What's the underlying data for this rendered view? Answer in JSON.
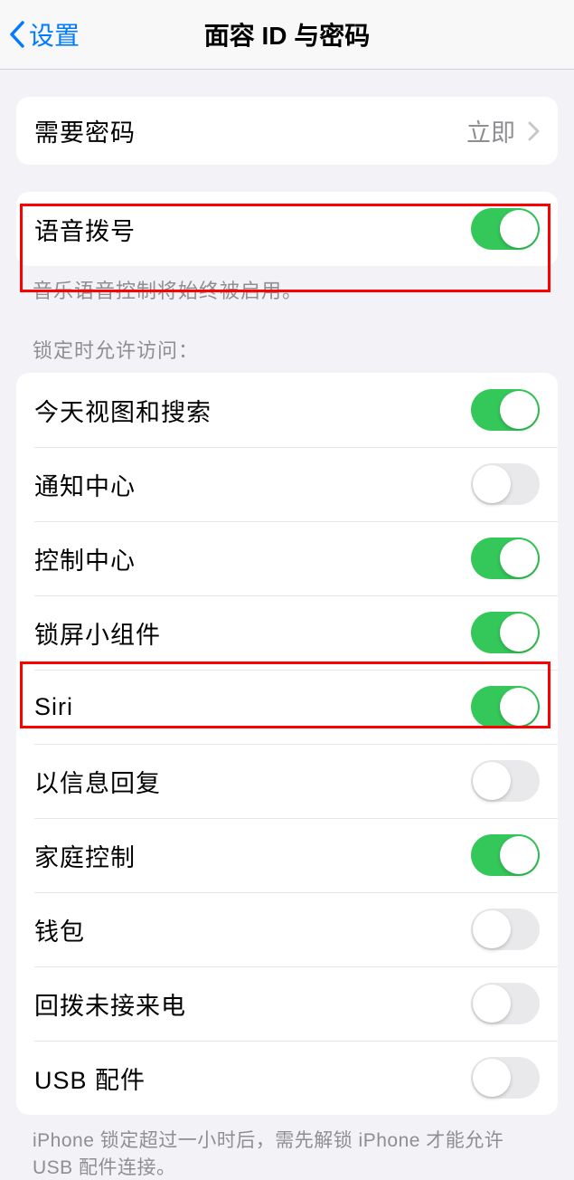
{
  "nav": {
    "back_label": "设置",
    "title": "面容 ID 与密码"
  },
  "passcode_group": {
    "require_passcode_label": "需要密码",
    "require_passcode_value": "立即"
  },
  "voice_dial": {
    "label": "语音拨号",
    "on": true,
    "footer": "音乐语音控制将始终被启用。"
  },
  "lock_access": {
    "header": "锁定时允许访问：",
    "items": [
      {
        "label": "今天视图和搜索",
        "on": true
      },
      {
        "label": "通知中心",
        "on": false
      },
      {
        "label": "控制中心",
        "on": true
      },
      {
        "label": "锁屏小组件",
        "on": true
      },
      {
        "label": "Siri",
        "on": true
      },
      {
        "label": "以信息回复",
        "on": false
      },
      {
        "label": "家庭控制",
        "on": true
      },
      {
        "label": "钱包",
        "on": false
      },
      {
        "label": "回拨未接来电",
        "on": false
      },
      {
        "label": "USB 配件",
        "on": false
      }
    ],
    "footer": "iPhone 锁定超过一小时后，需先解锁 iPhone 才能允许USB 配件连接。"
  }
}
